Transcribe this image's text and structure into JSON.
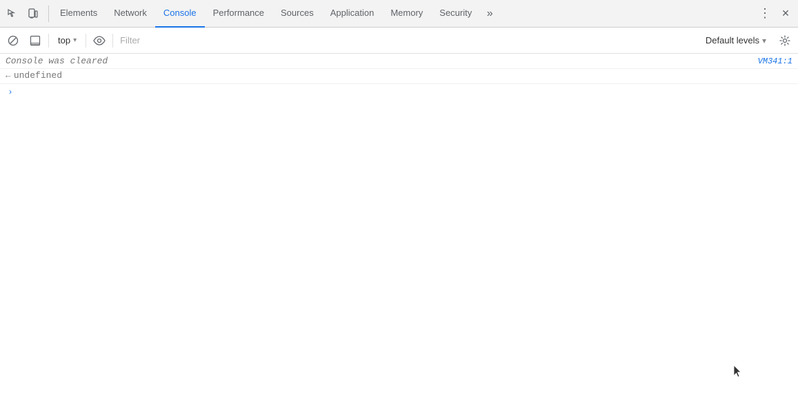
{
  "tabs": {
    "items": [
      {
        "id": "elements",
        "label": "Elements",
        "active": false
      },
      {
        "id": "network",
        "label": "Network",
        "active": false
      },
      {
        "id": "console",
        "label": "Console",
        "active": true
      },
      {
        "id": "performance",
        "label": "Performance",
        "active": false
      },
      {
        "id": "sources",
        "label": "Sources",
        "active": false
      },
      {
        "id": "application",
        "label": "Application",
        "active": false
      },
      {
        "id": "memory",
        "label": "Memory",
        "active": false
      },
      {
        "id": "security",
        "label": "Security",
        "active": false
      }
    ],
    "overflow_label": "»",
    "more_label": "⋮",
    "close_label": "✕"
  },
  "toolbar": {
    "context_value": "top",
    "filter_placeholder": "Filter",
    "default_levels_label": "Default levels",
    "chevron_down": "▾"
  },
  "console": {
    "cleared_message": "Console was cleared",
    "vm_link": "VM341:1",
    "undefined_label": "undefined",
    "lt_arrow": "←"
  },
  "icons": {
    "inspect": "⬜",
    "device": "📱",
    "no_entry": "🚫",
    "eye": "👁",
    "gear": "⚙",
    "chevron_right": "›"
  }
}
